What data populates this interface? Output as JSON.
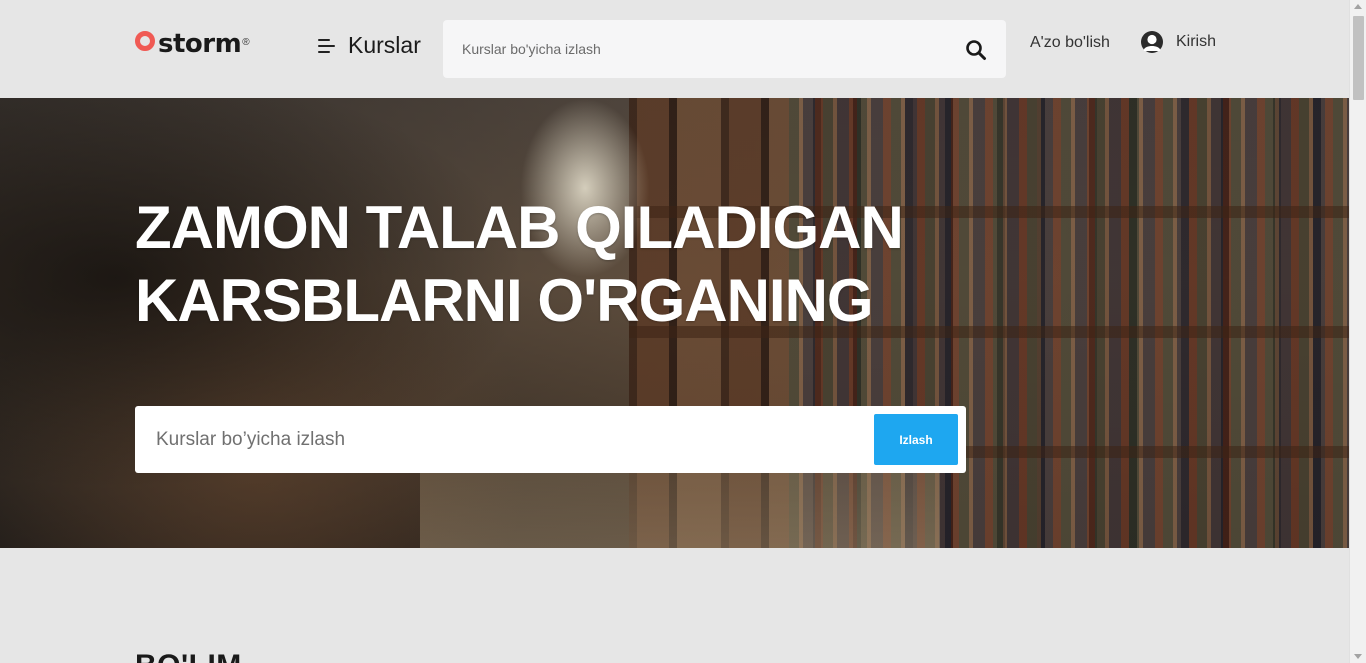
{
  "header": {
    "logo_text": "storm",
    "logo_reg": "®",
    "courses_label": "Kurslar",
    "search_placeholder": "Kurslar bo'yicha izlash",
    "signup_label": "A'zo bo'lish",
    "login_label": "Kirish",
    "icons": {
      "menu": "hamburger-menu-icon",
      "search": "search-icon",
      "user": "user-avatar-icon"
    }
  },
  "hero": {
    "title_line1": "ZAMON TALAB QILADIGAN",
    "title_line2": "KARSBLARNI O'RGANING",
    "search_placeholder": "Kurslar bo’yicha izlash",
    "search_button": "Izlash"
  },
  "section": {
    "title": "BO'LIM"
  },
  "colors": {
    "accent": "#1ea7f0",
    "logo_ring": "#f05a54",
    "page_bg": "#e6e6e6"
  }
}
